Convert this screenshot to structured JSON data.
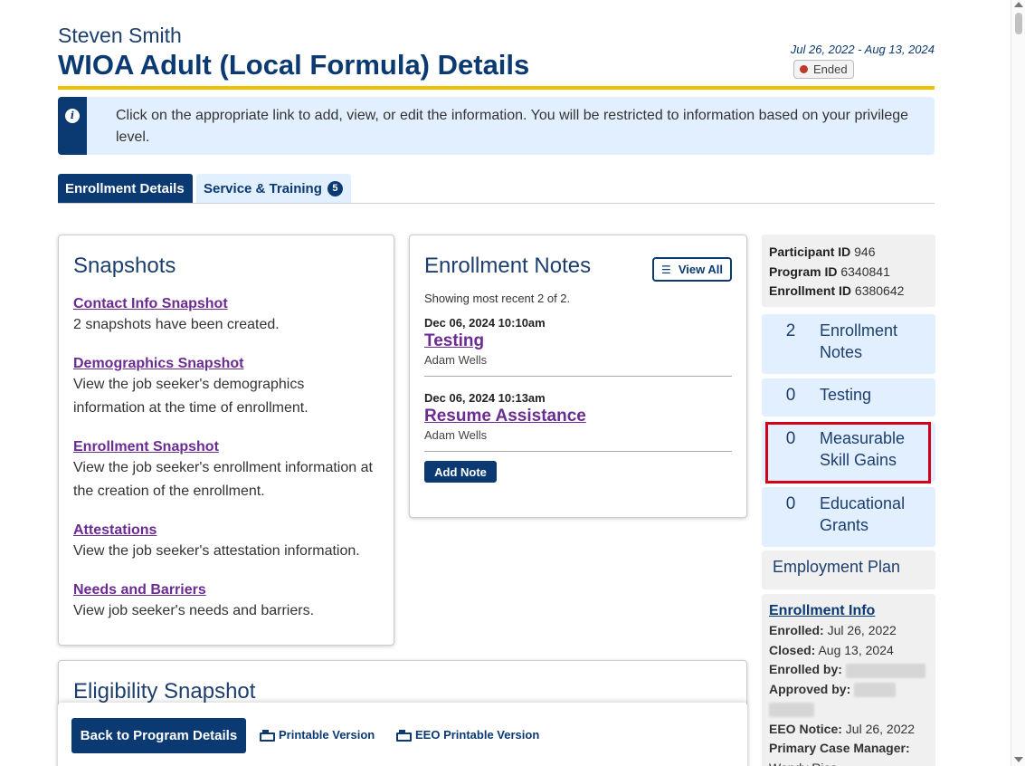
{
  "header": {
    "name": "Steven Smith",
    "title": "WIOA Adult (Local Formula) Details",
    "dates": "Jul 26, 2022 - Aug 13, 2024",
    "status": "Ended",
    "status_color": "#c0392b"
  },
  "info_banner": {
    "icon": "info-icon",
    "text": "Click on the appropriate link to add, view, or edit the information. You will be restricted to information based on your privilege level."
  },
  "tabs": [
    {
      "label": "Enrollment Details",
      "active": true
    },
    {
      "label": "Service & Training",
      "count": "5",
      "active": false
    }
  ],
  "snapshots": {
    "title": "Snapshots",
    "items": [
      {
        "link": "Contact Info Snapshot",
        "desc": "2 snapshots have been created."
      },
      {
        "link": "Demographics Snapshot",
        "desc": "View the job seeker's demographics information at the time of enrollment."
      },
      {
        "link": "Enrollment Snapshot",
        "desc": "View the job seeker's enrollment information at the creation of the enrollment."
      },
      {
        "link": "Attestations",
        "desc": "View the job seeker's attestation information."
      },
      {
        "link": "Needs and Barriers",
        "desc": "View job seeker's needs and barriers."
      }
    ]
  },
  "notes": {
    "title": "Enrollment Notes",
    "view_all": "View All",
    "showing": "Showing most recent 2 of 2.",
    "items": [
      {
        "date": "Dec 06, 2024 10:10am",
        "title": "Testing",
        "author": "Adam Wells"
      },
      {
        "date": "Dec 06, 2024 10:13am",
        "title": "Resume Assistance",
        "author": "Adam Wells"
      }
    ],
    "add_note": "Add Note"
  },
  "eligibility": {
    "title": "Eligibility Snapshot"
  },
  "sidebar": {
    "ids": [
      {
        "label": "Participant ID",
        "value": "946"
      },
      {
        "label": "Program ID",
        "value": "6340841"
      },
      {
        "label": "Enrollment ID",
        "value": "6380642"
      }
    ],
    "stats": [
      {
        "count": "2",
        "label": "Enrollment Notes"
      },
      {
        "count": "0",
        "label": "Testing"
      },
      {
        "count": "0",
        "label": "Measurable Skill Gains"
      },
      {
        "count": "0",
        "label": "Educational Grants"
      }
    ],
    "employment_plan": "Employment Plan",
    "enrollment_info": {
      "link": "Enrollment Info",
      "enrolled_label": "Enrolled:",
      "enrolled": "Jul 26, 2022",
      "closed_label": "Closed:",
      "closed": "Aug 13, 2024",
      "enrolled_by_label": "Enrolled by:",
      "approved_by_label": "Approved by:",
      "eeo_label": "EEO Notice:",
      "eeo": "Jul 26, 2022",
      "case_manager_label": "Primary Case Manager:",
      "case_manager": "Wendy Rios"
    }
  },
  "footer": {
    "back": "Back to Program Details",
    "printable": "Printable Version",
    "eeo_printable": "EEO Printable Version"
  }
}
